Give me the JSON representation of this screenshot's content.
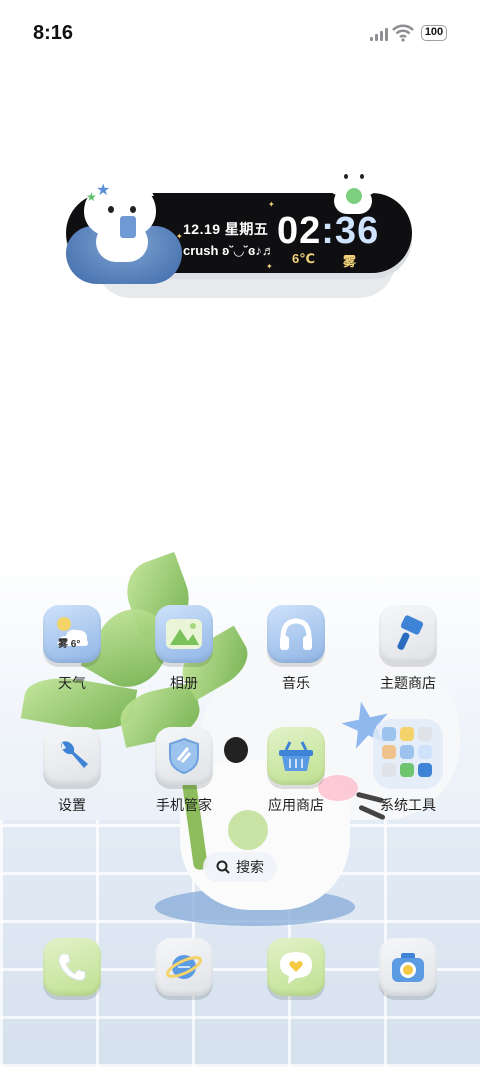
{
  "status_bar": {
    "time": "8:16",
    "battery": "100"
  },
  "widget": {
    "date": "12.19 星期五",
    "note": "crush ʚ˘◡˘ɞ♪♬",
    "clock_hours": "02",
    "clock_minutes": ":36",
    "temperature": "6℃",
    "weather": "雾"
  },
  "apps": [
    {
      "label": "天气",
      "icon": "weather-icon",
      "badge": "雾 6°"
    },
    {
      "label": "相册",
      "icon": "gallery-icon"
    },
    {
      "label": "音乐",
      "icon": "headphones-icon"
    },
    {
      "label": "主题商店",
      "icon": "paintbrush-icon"
    },
    {
      "label": "设置",
      "icon": "wrench-icon"
    },
    {
      "label": "手机管家",
      "icon": "shield-icon"
    },
    {
      "label": "应用商店",
      "icon": "basket-icon"
    },
    {
      "label": "系统工具",
      "icon": "folder-icon"
    }
  ],
  "search": {
    "label": "搜索"
  },
  "dock": [
    {
      "icon": "phone-icon"
    },
    {
      "icon": "browser-icon"
    },
    {
      "icon": "message-icon"
    },
    {
      "icon": "camera-icon"
    }
  ],
  "colors": {
    "tile_blue": "#a9c9f0",
    "tile_green": "#d4eab6",
    "tile_gray": "#eceef1",
    "widget_bg": "#0f0f12",
    "accent_gold": "#f2d27a"
  }
}
